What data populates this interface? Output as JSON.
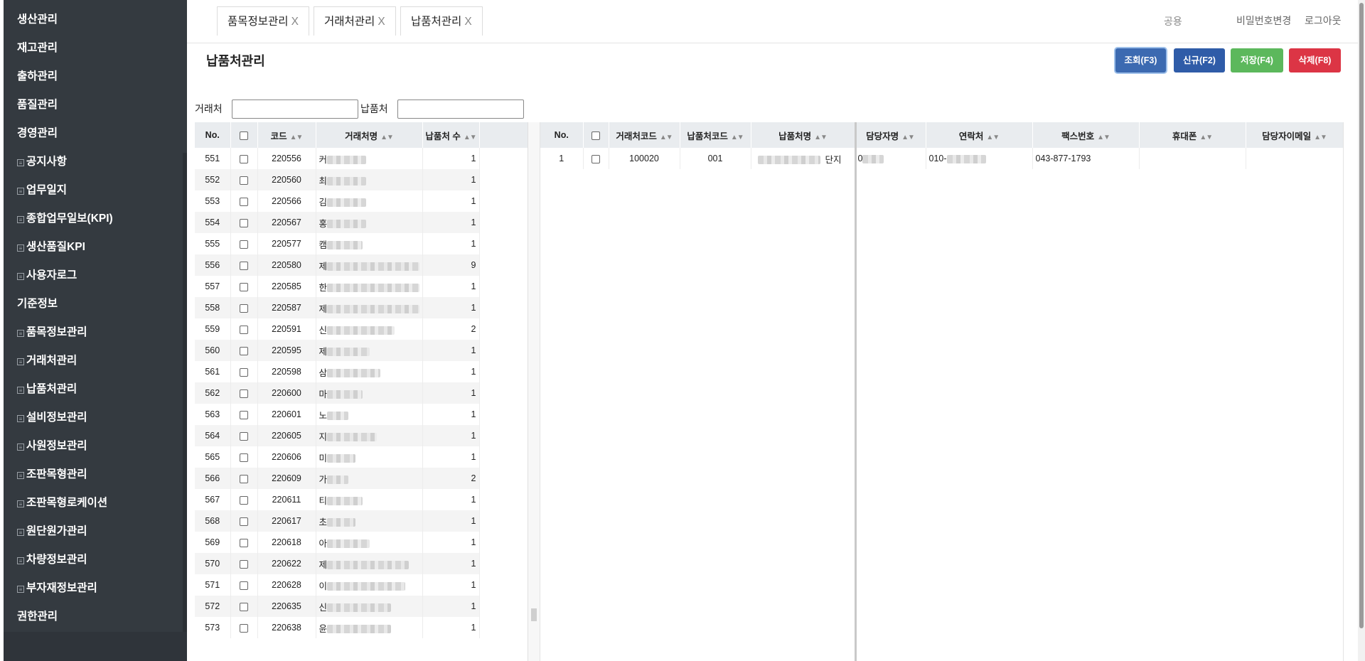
{
  "sidebar": {
    "items": [
      {
        "label": "생산관리",
        "sub": false
      },
      {
        "label": "재고관리",
        "sub": false
      },
      {
        "label": "출하관리",
        "sub": false
      },
      {
        "label": "품질관리",
        "sub": false
      },
      {
        "label": "경영관리",
        "sub": false
      },
      {
        "label": "공지사항",
        "sub": true
      },
      {
        "label": "업무일지",
        "sub": true
      },
      {
        "label": "종합업무일보(KPI)",
        "sub": true
      },
      {
        "label": "생산품질KPI",
        "sub": true
      },
      {
        "label": "사용자로그",
        "sub": true
      },
      {
        "label": "기준정보",
        "sub": false
      },
      {
        "label": "품목정보관리",
        "sub": true
      },
      {
        "label": "거래처관리",
        "sub": true
      },
      {
        "label": "납품처관리",
        "sub": true
      },
      {
        "label": "설비정보관리",
        "sub": true
      },
      {
        "label": "사원정보관리",
        "sub": true
      },
      {
        "label": "조판목형관리",
        "sub": true
      },
      {
        "label": "조판목형로케이션",
        "sub": true
      },
      {
        "label": "원단원가관리",
        "sub": true
      },
      {
        "label": "차량정보관리",
        "sub": true
      },
      {
        "label": "부자재정보관리",
        "sub": true
      },
      {
        "label": "권한관리",
        "sub": false
      }
    ]
  },
  "tabs": [
    {
      "label": "품목정보관리",
      "close": "X"
    },
    {
      "label": "거래처관리",
      "close": "X"
    },
    {
      "label": "납품처관리",
      "close": "X"
    }
  ],
  "topbar": {
    "user": "공용",
    "change_password": "비밀번호변경",
    "logout": "로그아웃"
  },
  "page": {
    "title": "납품처관리"
  },
  "buttons": {
    "search": "조회(F3)",
    "new": "신규(F2)",
    "save": "저장(F4)",
    "delete": "삭제(F8)"
  },
  "colors": {
    "search": "#3c6ab1",
    "new": "#2f5ca8",
    "save": "#5cb85c",
    "delete": "#dc3545",
    "sidebar": "#343a40"
  },
  "filter": {
    "client_label": "거래처",
    "client_value": "",
    "delivery_label": "납품처",
    "delivery_value": ""
  },
  "left_grid": {
    "headers": {
      "no": "No.",
      "code": "코드",
      "name": "거래처명",
      "count": "납품처 수"
    },
    "rows": [
      {
        "no": "551",
        "code": "220556",
        "name_prefix": "커",
        "count": "1"
      },
      {
        "no": "552",
        "code": "220560",
        "name_prefix": "최",
        "count": "1"
      },
      {
        "no": "553",
        "code": "220566",
        "name_prefix": "김",
        "count": "1"
      },
      {
        "no": "554",
        "code": "220567",
        "name_prefix": "홍",
        "count": "1"
      },
      {
        "no": "555",
        "code": "220577",
        "name_prefix": "캠",
        "count": "1"
      },
      {
        "no": "556",
        "code": "220580",
        "name_prefix": "제",
        "count": "9"
      },
      {
        "no": "557",
        "code": "220585",
        "name_prefix": "한",
        "count": "1"
      },
      {
        "no": "558",
        "code": "220587",
        "name_prefix": "제",
        "count": "1"
      },
      {
        "no": "559",
        "code": "220591",
        "name_prefix": "신",
        "count": "2"
      },
      {
        "no": "560",
        "code": "220595",
        "name_prefix": "제",
        "count": "1"
      },
      {
        "no": "561",
        "code": "220598",
        "name_prefix": "삼",
        "count": "1"
      },
      {
        "no": "562",
        "code": "220600",
        "name_prefix": "마",
        "count": "1"
      },
      {
        "no": "563",
        "code": "220601",
        "name_prefix": "노",
        "count": "1"
      },
      {
        "no": "564",
        "code": "220605",
        "name_prefix": "지",
        "count": "1"
      },
      {
        "no": "565",
        "code": "220606",
        "name_prefix": "미",
        "count": "1"
      },
      {
        "no": "566",
        "code": "220609",
        "name_prefix": "가",
        "count": "2"
      },
      {
        "no": "567",
        "code": "220611",
        "name_prefix": "티",
        "count": "1"
      },
      {
        "no": "568",
        "code": "220617",
        "name_prefix": "초",
        "count": "1"
      },
      {
        "no": "569",
        "code": "220618",
        "name_prefix": "아",
        "count": "1"
      },
      {
        "no": "570",
        "code": "220622",
        "name_prefix": "제",
        "count": "1"
      },
      {
        "no": "571",
        "code": "220628",
        "name_prefix": "이",
        "count": "1"
      },
      {
        "no": "572",
        "code": "220635",
        "name_prefix": "신",
        "count": "1"
      },
      {
        "no": "573",
        "code": "220638",
        "name_prefix": "윤",
        "count": "1"
      }
    ]
  },
  "right_grid": {
    "headers": {
      "no": "No.",
      "client_code": "거래처코드",
      "delivery_code": "납품처코드",
      "delivery_name": "납품처명",
      "manager": "담당자명",
      "contact": "연락처",
      "fax": "팩스번호",
      "mobile": "휴대폰",
      "email": "담당자이메일"
    },
    "rows": [
      {
        "no": "1",
        "client_code": "100020",
        "delivery_code": "001",
        "delivery_name_suffix": "단지",
        "manager_prefix": "0",
        "contact_prefix": "010-",
        "fax": "043-877-1793",
        "mobile": "",
        "email": ""
      }
    ]
  }
}
